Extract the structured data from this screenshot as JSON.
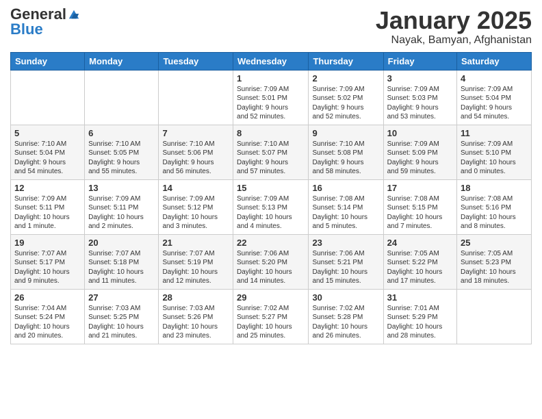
{
  "logo": {
    "general": "General",
    "blue": "Blue"
  },
  "header": {
    "month": "January 2025",
    "location": "Nayak, Bamyan, Afghanistan"
  },
  "days_of_week": [
    "Sunday",
    "Monday",
    "Tuesday",
    "Wednesday",
    "Thursday",
    "Friday",
    "Saturday"
  ],
  "weeks": [
    [
      {
        "day": "",
        "info": ""
      },
      {
        "day": "",
        "info": ""
      },
      {
        "day": "",
        "info": ""
      },
      {
        "day": "1",
        "info": "Sunrise: 7:09 AM\nSunset: 5:01 PM\nDaylight: 9 hours\nand 52 minutes."
      },
      {
        "day": "2",
        "info": "Sunrise: 7:09 AM\nSunset: 5:02 PM\nDaylight: 9 hours\nand 52 minutes."
      },
      {
        "day": "3",
        "info": "Sunrise: 7:09 AM\nSunset: 5:03 PM\nDaylight: 9 hours\nand 53 minutes."
      },
      {
        "day": "4",
        "info": "Sunrise: 7:09 AM\nSunset: 5:04 PM\nDaylight: 9 hours\nand 54 minutes."
      }
    ],
    [
      {
        "day": "5",
        "info": "Sunrise: 7:10 AM\nSunset: 5:04 PM\nDaylight: 9 hours\nand 54 minutes."
      },
      {
        "day": "6",
        "info": "Sunrise: 7:10 AM\nSunset: 5:05 PM\nDaylight: 9 hours\nand 55 minutes."
      },
      {
        "day": "7",
        "info": "Sunrise: 7:10 AM\nSunset: 5:06 PM\nDaylight: 9 hours\nand 56 minutes."
      },
      {
        "day": "8",
        "info": "Sunrise: 7:10 AM\nSunset: 5:07 PM\nDaylight: 9 hours\nand 57 minutes."
      },
      {
        "day": "9",
        "info": "Sunrise: 7:10 AM\nSunset: 5:08 PM\nDaylight: 9 hours\nand 58 minutes."
      },
      {
        "day": "10",
        "info": "Sunrise: 7:09 AM\nSunset: 5:09 PM\nDaylight: 9 hours\nand 59 minutes."
      },
      {
        "day": "11",
        "info": "Sunrise: 7:09 AM\nSunset: 5:10 PM\nDaylight: 10 hours\nand 0 minutes."
      }
    ],
    [
      {
        "day": "12",
        "info": "Sunrise: 7:09 AM\nSunset: 5:11 PM\nDaylight: 10 hours\nand 1 minute."
      },
      {
        "day": "13",
        "info": "Sunrise: 7:09 AM\nSunset: 5:11 PM\nDaylight: 10 hours\nand 2 minutes."
      },
      {
        "day": "14",
        "info": "Sunrise: 7:09 AM\nSunset: 5:12 PM\nDaylight: 10 hours\nand 3 minutes."
      },
      {
        "day": "15",
        "info": "Sunrise: 7:09 AM\nSunset: 5:13 PM\nDaylight: 10 hours\nand 4 minutes."
      },
      {
        "day": "16",
        "info": "Sunrise: 7:08 AM\nSunset: 5:14 PM\nDaylight: 10 hours\nand 5 minutes."
      },
      {
        "day": "17",
        "info": "Sunrise: 7:08 AM\nSunset: 5:15 PM\nDaylight: 10 hours\nand 7 minutes."
      },
      {
        "day": "18",
        "info": "Sunrise: 7:08 AM\nSunset: 5:16 PM\nDaylight: 10 hours\nand 8 minutes."
      }
    ],
    [
      {
        "day": "19",
        "info": "Sunrise: 7:07 AM\nSunset: 5:17 PM\nDaylight: 10 hours\nand 9 minutes."
      },
      {
        "day": "20",
        "info": "Sunrise: 7:07 AM\nSunset: 5:18 PM\nDaylight: 10 hours\nand 11 minutes."
      },
      {
        "day": "21",
        "info": "Sunrise: 7:07 AM\nSunset: 5:19 PM\nDaylight: 10 hours\nand 12 minutes."
      },
      {
        "day": "22",
        "info": "Sunrise: 7:06 AM\nSunset: 5:20 PM\nDaylight: 10 hours\nand 14 minutes."
      },
      {
        "day": "23",
        "info": "Sunrise: 7:06 AM\nSunset: 5:21 PM\nDaylight: 10 hours\nand 15 minutes."
      },
      {
        "day": "24",
        "info": "Sunrise: 7:05 AM\nSunset: 5:22 PM\nDaylight: 10 hours\nand 17 minutes."
      },
      {
        "day": "25",
        "info": "Sunrise: 7:05 AM\nSunset: 5:23 PM\nDaylight: 10 hours\nand 18 minutes."
      }
    ],
    [
      {
        "day": "26",
        "info": "Sunrise: 7:04 AM\nSunset: 5:24 PM\nDaylight: 10 hours\nand 20 minutes."
      },
      {
        "day": "27",
        "info": "Sunrise: 7:03 AM\nSunset: 5:25 PM\nDaylight: 10 hours\nand 21 minutes."
      },
      {
        "day": "28",
        "info": "Sunrise: 7:03 AM\nSunset: 5:26 PM\nDaylight: 10 hours\nand 23 minutes."
      },
      {
        "day": "29",
        "info": "Sunrise: 7:02 AM\nSunset: 5:27 PM\nDaylight: 10 hours\nand 25 minutes."
      },
      {
        "day": "30",
        "info": "Sunrise: 7:02 AM\nSunset: 5:28 PM\nDaylight: 10 hours\nand 26 minutes."
      },
      {
        "day": "31",
        "info": "Sunrise: 7:01 AM\nSunset: 5:29 PM\nDaylight: 10 hours\nand 28 minutes."
      },
      {
        "day": "",
        "info": ""
      }
    ]
  ]
}
